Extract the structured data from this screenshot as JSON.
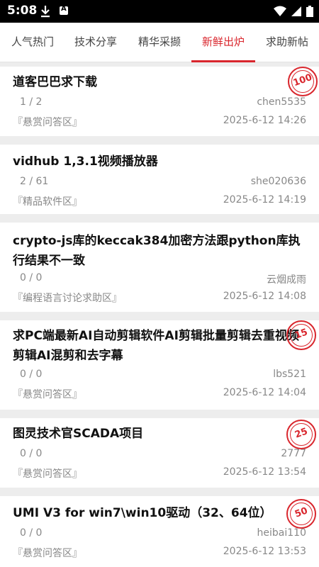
{
  "status": {
    "time": "5:08"
  },
  "tabs": [
    {
      "label": "人气热门"
    },
    {
      "label": "技术分享"
    },
    {
      "label": "精华采撷"
    },
    {
      "label": "新鲜出炉"
    },
    {
      "label": "求助新帖"
    }
  ],
  "posts": [
    {
      "title": "道客巴巴求下载",
      "replies": "1 / 2",
      "author": "chen5535",
      "forum": "『悬赏问答区』",
      "date": "2025-6-12 14:26",
      "bounty": "100"
    },
    {
      "title": "vidhub 1,3.1视频播放器",
      "replies": "2 / 61",
      "author": "she020636",
      "forum": "『精品软件区』",
      "date": "2025-6-12 14:19"
    },
    {
      "title": "crypto-js库的keccak384加密方法跟python库执行结果不一致",
      "replies": "0 / 0",
      "author": "云烟成雨",
      "forum": "『编程语言讨论求助区』",
      "date": "2025-6-12 14:08"
    },
    {
      "title": "求PC端最新AI自动剪辑软件AI剪辑批量剪辑去重视频剪辑AI混剪和去字幕",
      "replies": "0 / 0",
      "author": "lbs521",
      "forum": "『悬赏问答区』",
      "date": "2025-6-12 14:04",
      "bounty": "15"
    },
    {
      "title": "图灵技术官SCADA项目",
      "replies": "0 / 0",
      "author": "2777",
      "forum": "『悬赏问答区』",
      "date": "2025-6-12 13:54",
      "bounty": "25"
    },
    {
      "title": "UMI V3 for win7\\win10驱动（32、64位）",
      "replies": "0 / 0",
      "author": "heibai110",
      "forum": "『悬赏问答区』",
      "date": "2025-6-12 13:53",
      "bounty": "50"
    }
  ]
}
